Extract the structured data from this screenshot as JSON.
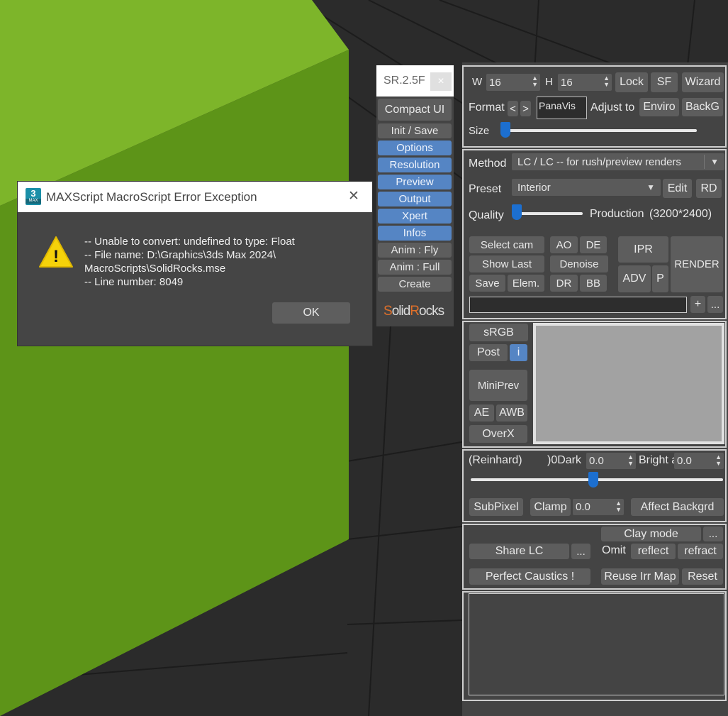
{
  "colors": {
    "viewport_bg": "#2c2c2c",
    "cube_light": "#7db52a",
    "cube_dark": "#5d9418",
    "accent": "#5585c4",
    "slider": "#1c6fd0"
  },
  "launcher": {
    "title": "SR.2.5F",
    "close": "×",
    "buttons": [
      "Compact UI",
      "Init / Save",
      "Options",
      "Resolution",
      "Preview",
      "Output",
      "Xpert",
      "Infos",
      "Anim : Fly",
      "Anim : Full",
      "Create"
    ],
    "logo_s": "S",
    "logo_olid": "olid",
    "logo_r": "R",
    "logo_ocks": "ocks"
  },
  "dialog": {
    "title": "MAXScript MacroScript Error Exception",
    "app_icon_top": "3",
    "app_icon_bottom": "MAX",
    "warning_glyph": "!",
    "lines": [
      "-- Unable to convert: undefined to type: Float",
      "-- File name: D:\\Graphics\\3ds Max 2024\\",
      "MacroScripts\\SolidRocks.mse",
      "-- Line number: 8049"
    ],
    "ok_label": "OK",
    "close": "✕"
  },
  "panel": {
    "res": {
      "w_label": "W",
      "w_value": "16",
      "h_label": "H",
      "h_value": "16",
      "lock": "Lock",
      "sf": "SF",
      "wizard": "Wizard",
      "format_label": "Format",
      "prev": "<",
      "next": ">",
      "format_value": "PanaVis",
      "adjust_label": "Adjust to",
      "enviro": "Enviro",
      "backg": "BackG",
      "size_label": "Size",
      "size_level": 0.02
    },
    "render": {
      "method_label": "Method",
      "method_value": "LC / LC -- for rush/preview renders",
      "preset_label": "Preset",
      "preset_value": "Interior",
      "edit": "Edit",
      "rd": "RD",
      "quality_label": "Quality",
      "quality_level": 0.05,
      "quality_value": "Production",
      "quality_res": "(3200*2400)",
      "select_cam": "Select cam",
      "ao": "AO",
      "de": "DE",
      "ipr": "IPR",
      "render": "RENDER",
      "show_last": "Show Last",
      "denoise": "Denoise",
      "adv": "ADV",
      "p": "P",
      "save": "Save",
      "elem": "Elem.",
      "dr": "DR",
      "bb": "BB",
      "path_value": "",
      "plus": "+",
      "more": "..."
    },
    "preview": {
      "srgb": "sRGB",
      "post": "Post",
      "i": "i",
      "miniprev": "MiniPrev",
      "ae": "AE",
      "awb": "AWB",
      "overx": "OverX"
    },
    "tone": {
      "mapper": "(Reinhard)",
      "dark_label": ")0Dark",
      "dark_value": "0.0",
      "bright_label": "Bright a",
      "bright_value": "0.0",
      "level": 0.49,
      "subpixel": "SubPixel",
      "clamp": "Clamp",
      "clamp_value": "0.0",
      "affect": "Affect Backgrd"
    },
    "misc": {
      "clay": "Clay mode",
      "clay_more": "...",
      "share": "Share LC",
      "share_more": "...",
      "omit": "Omit",
      "reflect": "reflect",
      "refract": "refract",
      "caustics": "Perfect Caustics !",
      "reuse": "Reuse Irr Map",
      "reset": "Reset"
    },
    "log": ""
  }
}
